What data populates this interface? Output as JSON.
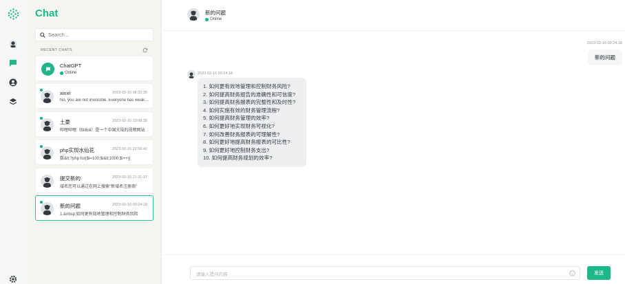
{
  "app": {
    "accent": "#1fb78a"
  },
  "rail": {
    "logo_icon": "dots-logo-icon",
    "items": [
      "profile-icon",
      "chat-bubble-icon",
      "user-circle-icon",
      "layers-icon"
    ],
    "settings_icon": "gear-icon"
  },
  "sidebar": {
    "title": "Chat",
    "search_placeholder": "Search...",
    "recent_label": "RECENT CHATS",
    "gpt": {
      "name": "ChatGPT",
      "status": "Online"
    },
    "chats": [
      {
        "name": "xinxi",
        "time": "2023-02-15 08:32:35",
        "preview": "No, you are not invincible. Everyone has weaknesses",
        "active": false
      },
      {
        "name": "土豪",
        "time": "2023-02-15 23:08:35",
        "preview": "哔哩哔哩（Bilibili）是一个中国大陆的视频网站",
        "active": false
      },
      {
        "name": "php实现水仙花",
        "time": "2023-02-15 22:59:42",
        "preview": "数&lt;?php for($i=100;$i&lt;1000;$i++){",
        "active": false
      },
      {
        "name": "提交新的",
        "time": "2023-02-15 21:31:37",
        "preview": "域名您可以通过在网上搜索\"新域名注册商\"",
        "active": false
      },
      {
        "name": "新的问题",
        "time": "2023-02-16 00:24:18",
        "preview": "1.&nbsp;如何更有效地管理和控制财务风险",
        "active": true
      }
    ]
  },
  "header": {
    "name": "新的问题",
    "status": "Online"
  },
  "messages": {
    "user": {
      "time": "2023-02-16 00:24:18",
      "text": "新的问题"
    },
    "bot": {
      "time": "2023-02-16 00:24:18",
      "lines": [
        "1. 如何更有效地管理和控制财务风险?",
        "2. 如何提高财务报告的准确性和可信度?",
        "3. 如何提高财务报表的完整性和及时性?",
        "4. 如何实施有效的财务管理流程?",
        "5. 如何提高财务管理的效率?",
        "6. 如何更好地实现财务可视化?",
        "7. 如何改善财务报表的可理解性?",
        "8. 如何更好地提高财务报表的可比性?",
        "9. 如何更好地控制财务支出?",
        "10. 如何提高财务规划的效率?"
      ]
    }
  },
  "composer": {
    "placeholder": "请输入提问内容",
    "send_label": "发送"
  }
}
